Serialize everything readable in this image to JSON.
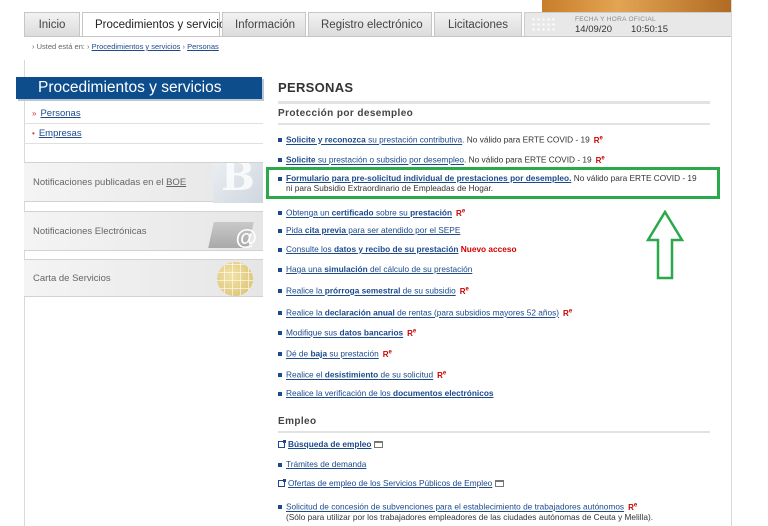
{
  "nav": {
    "tabs": [
      {
        "label": "Inicio"
      },
      {
        "label": "Procedimientos y servicios"
      },
      {
        "label": "Información"
      },
      {
        "label": "Registro electrónico"
      },
      {
        "label": "Licitaciones"
      }
    ],
    "clock_label": "Fecha y hora oficial",
    "date": "14/09/20",
    "time": "10:50:15"
  },
  "breadcrumb": {
    "prefix": "› Usted está en: ›",
    "items": [
      "Procedimientos y servicios",
      "Personas"
    ],
    "separator": "›"
  },
  "sidebar": {
    "title": "Procedimientos y servicios",
    "items": [
      {
        "bullet": "»",
        "label": "Personas"
      },
      {
        "bullet": "•",
        "label": "Empresas"
      }
    ],
    "blocks": [
      {
        "prefix": "Notificaciones publicadas en el ",
        "link": "BOE"
      },
      {
        "label": "Notificaciones Electrónicas"
      },
      {
        "label": "Carta de Servicios"
      }
    ],
    "boe_image_text": "B"
  },
  "main": {
    "title": "Personas",
    "section1": "Protección por desempleo",
    "section2": "Empleo",
    "re_mark": "R",
    "re_sup": "e",
    "links": [
      {
        "parts": [
          "Solicite y reconozca",
          " su ",
          "prestación contributiva",
          "."
        ],
        "note": " No válido para ERTE COVID - 19"
      },
      {
        "parts": [
          "Solicite",
          " su ",
          "prestación o subsidio por desempleo",
          "."
        ],
        "note": " No válido para ERTE COVID - 19"
      },
      {
        "parts": [
          "Formulario para pre-solicitud individual de prestaciones por desempleo."
        ],
        "note": " No válido para ERTE COVID - 19",
        "note2": "ni para Subsidio Extraordinario de Empleadas de Hogar."
      },
      {
        "parts": [
          "Obtenga un ",
          "certificado",
          " sobre su ",
          "prestación"
        ]
      },
      {
        "parts": [
          "Pida ",
          "cita previa",
          " para ser atendido por el SEPE"
        ]
      },
      {
        "parts": [
          "Consulte los ",
          "datos y recibo de su prestación"
        ],
        "new": " Nuevo acceso"
      },
      {
        "parts": [
          "Haga una ",
          "simulación",
          " del cálculo de su prestación"
        ]
      },
      {
        "parts": [
          "Realice la ",
          "prórroga semestral",
          " de su subsidio"
        ]
      },
      {
        "parts": [
          "Realice la ",
          "declaración anual",
          " de rentas (para subsidios mayores 52 años)"
        ]
      },
      {
        "parts": [
          "Modifique sus ",
          "datos bancarios"
        ]
      },
      {
        "parts": [
          "Dé de ",
          "baja",
          " su prestación"
        ]
      },
      {
        "parts": [
          "Realice el ",
          "desistimiento",
          " de su solicitud"
        ]
      },
      {
        "parts": [
          "Realice la verificación de los ",
          "documentos electrónicos"
        ]
      }
    ],
    "empleo_links": [
      {
        "label": "Búsqueda de empleo"
      },
      {
        "label": "Trámites de demanda"
      },
      {
        "label": "Ofertas de empleo de los Servicios Públicos de Empleo"
      },
      {
        "label": "Solicitud de concesión de subvenciones para el establecimiento de trabajadores autónomos",
        "note": "(Sólo para utilizar por los trabajadores empleadores de las ciudades autónomas de Ceuta y Melilla)."
      }
    ]
  },
  "colors": {
    "highlight": "#2aa84a",
    "brand": "#0e4d8c",
    "link": "#1c4a8c",
    "new": "#d40000"
  }
}
